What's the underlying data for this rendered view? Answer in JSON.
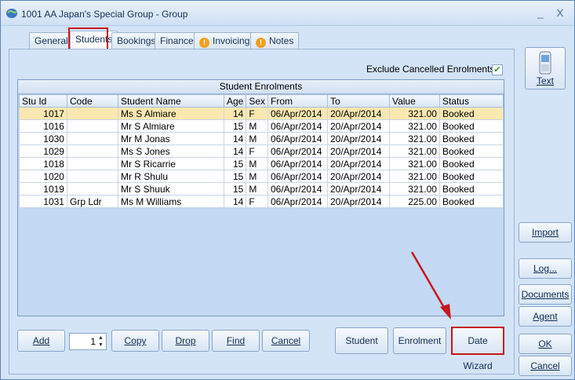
{
  "window": {
    "title": "1001 AA Japan's Special Group - Group",
    "minimize_glyph": "_",
    "close_glyph": "X"
  },
  "tabs": [
    {
      "label": "General"
    },
    {
      "label": "Students"
    },
    {
      "label": "Bookings"
    },
    {
      "label": "Finance"
    },
    {
      "label": "Invoicing",
      "icon": "warning-icon",
      "badge": "!"
    },
    {
      "label": "Notes",
      "icon": "warning-icon",
      "badge": "!"
    }
  ],
  "filter": {
    "exclude_label": "Exclude Cancelled Enrolments",
    "exclude_checked": true,
    "check_glyph": "✔"
  },
  "grid": {
    "caption": "Student Enrolments",
    "columns": [
      "Stu Id",
      "Code",
      "Student Name",
      "Age",
      "Sex",
      "From",
      "To",
      "Value",
      "Status"
    ],
    "rows": [
      [
        "1017",
        "",
        "Ms S Almiare",
        "14",
        "F",
        "06/Apr/2014",
        "20/Apr/2014",
        "321.00",
        "Booked"
      ],
      [
        "1016",
        "",
        "Mr S Almiare",
        "15",
        "M",
        "06/Apr/2014",
        "20/Apr/2014",
        "321.00",
        "Booked"
      ],
      [
        "1030",
        "",
        "Mr M Jonas",
        "14",
        "M",
        "06/Apr/2014",
        "20/Apr/2014",
        "321.00",
        "Booked"
      ],
      [
        "1029",
        "",
        "Ms S Jones",
        "14",
        "F",
        "06/Apr/2014",
        "20/Apr/2014",
        "321.00",
        "Booked"
      ],
      [
        "1018",
        "",
        "Mr S Ricarrie",
        "15",
        "M",
        "06/Apr/2014",
        "20/Apr/2014",
        "321.00",
        "Booked"
      ],
      [
        "1020",
        "",
        "Mr R Shulu",
        "15",
        "M",
        "06/Apr/2014",
        "20/Apr/2014",
        "321.00",
        "Booked"
      ],
      [
        "1019",
        "",
        "Mr S Shuuk",
        "15",
        "M",
        "06/Apr/2014",
        "20/Apr/2014",
        "321.00",
        "Booked"
      ],
      [
        "1031",
        "Grp Ldr",
        "Ms M Williams",
        "14",
        "F",
        "06/Apr/2014",
        "20/Apr/2014",
        "225.00",
        "Booked"
      ]
    ]
  },
  "bottom_buttons": {
    "add": "Add",
    "quantity": "1",
    "copy": "Copy",
    "drop": "Drop",
    "find": "Find",
    "cancel": "Cancel",
    "student": "Student",
    "enrolment": "Enrolment",
    "date_wizard": "Date Wizard"
  },
  "side_buttons": {
    "text": "Text",
    "import": "Import",
    "log": "Log...",
    "documents": "Documents",
    "agent": "Agent",
    "ok": "OK",
    "cancel": "Cancel"
  },
  "colors": {
    "highlight_box": "#c8161d",
    "selected_row": "#fbe8b0",
    "grid_background": "#c4d9f3"
  }
}
